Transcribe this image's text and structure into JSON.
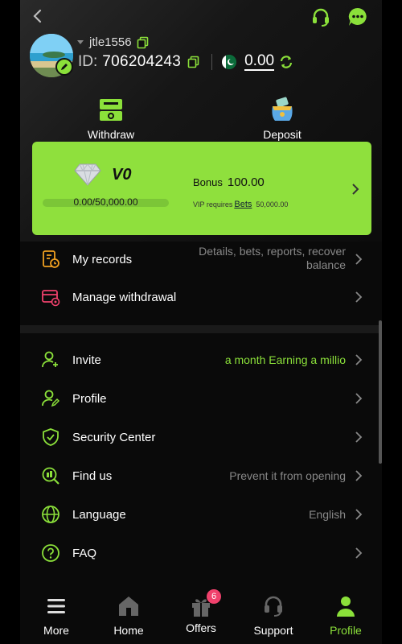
{
  "user": {
    "username": "jtle1556",
    "id_label": "ID:",
    "id_value": "706204243",
    "balance": "0.00"
  },
  "shortcuts": {
    "withdraw": "Withdraw",
    "deposit": "Deposit"
  },
  "vip": {
    "level": "V0",
    "progress_text": "0.00/50,000.00",
    "progress_fraction": 0,
    "bonus_label": "Bonus",
    "bonus_value": "100.00",
    "requires_label": "VIP requires",
    "bets_label": "Bets",
    "requires_value": "50,000.00"
  },
  "records_menu": [
    {
      "label": "My records",
      "value_line1": "Details, bets, reports, recover",
      "value_line2": "balance",
      "icon": "records-icon"
    },
    {
      "label": "Manage withdrawal",
      "value": "",
      "icon": "withdrawal-card-icon"
    }
  ],
  "settings_menu": [
    {
      "label": "Invite",
      "value": "a month  Earning a millio",
      "icon": "invite-user-icon"
    },
    {
      "label": "Profile",
      "value": "",
      "icon": "profile-edit-icon"
    },
    {
      "label": "Security Center",
      "value": "",
      "icon": "shield-check-icon"
    },
    {
      "label": "Find us",
      "value": "Prevent it from opening",
      "icon": "search-building-icon"
    },
    {
      "label": "Language",
      "value": "English",
      "icon": "globe-icon"
    },
    {
      "label": "FAQ",
      "value": "",
      "icon": "question-icon"
    }
  ],
  "tabs": [
    {
      "label": "More",
      "icon": "menu-icon"
    },
    {
      "label": "Home",
      "icon": "home-icon"
    },
    {
      "label": "Offers",
      "icon": "gift-icon",
      "badge": "6"
    },
    {
      "label": "Support",
      "icon": "headset-icon"
    },
    {
      "label": "Profile",
      "icon": "user-icon"
    }
  ],
  "colors": {
    "accent": "#8be03a",
    "vip_card": "#8fe03d",
    "badge": "#f0416c",
    "icon_orange": "#f0a020",
    "icon_red": "#f0416c"
  }
}
